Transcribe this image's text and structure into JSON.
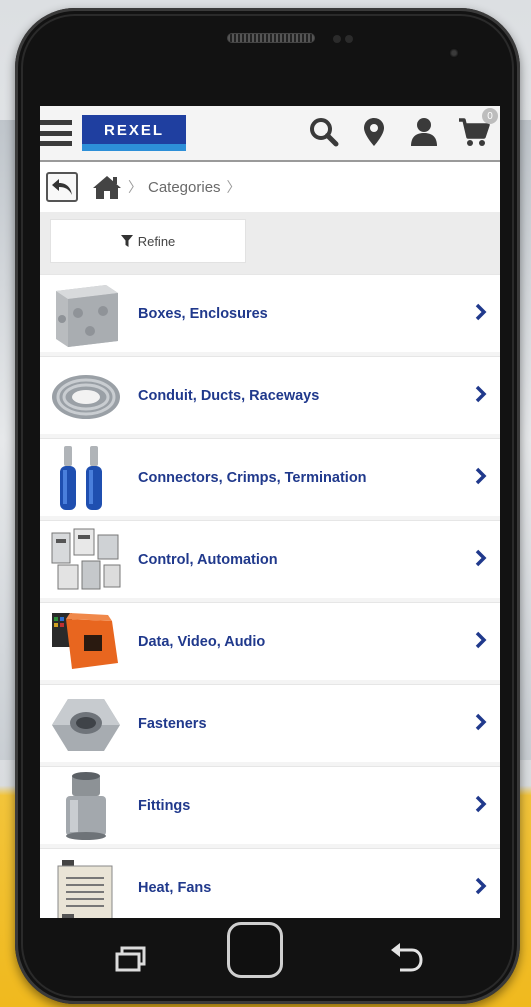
{
  "app": {
    "brand": "Rexel",
    "logo_text": "REXEL",
    "cart_count": "0",
    "colors": {
      "brand_blue": "#1f3fa0",
      "brand_light_blue": "#2d8fd8",
      "label_blue": "#20398c"
    }
  },
  "header": {
    "icons": [
      "menu-icon",
      "search-icon",
      "location-pin-icon",
      "user-icon",
      "cart-icon"
    ]
  },
  "breadcrumb": {
    "items": [
      "Categories"
    ]
  },
  "refine": {
    "label": "Refine"
  },
  "categories": [
    {
      "label": "Boxes, Enclosures"
    },
    {
      "label": "Conduit, Ducts, Raceways"
    },
    {
      "label": "Connectors, Crimps, Termination"
    },
    {
      "label": "Control, Automation"
    },
    {
      "label": "Data, Video, Audio"
    },
    {
      "label": "Fasteners"
    },
    {
      "label": "Fittings"
    },
    {
      "label": "Heat, Fans"
    }
  ],
  "device_nav": [
    "recent-apps-icon",
    "home-button",
    "back-icon"
  ]
}
